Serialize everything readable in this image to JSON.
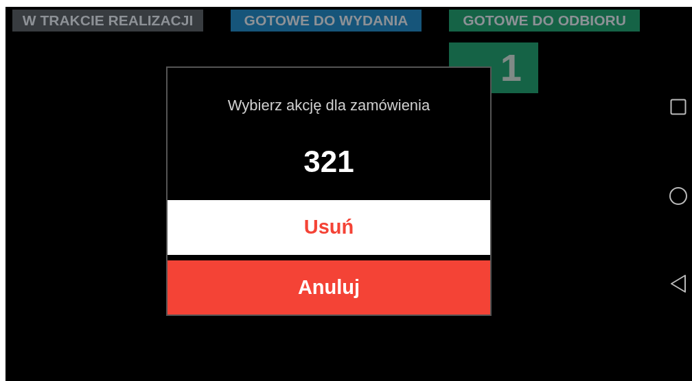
{
  "columns": [
    {
      "title": "W TRAKCIE REALIZACJI",
      "kind": "in_progress"
    },
    {
      "title": "GOTOWE DO WYDANIA",
      "kind": "ready_to_issue"
    },
    {
      "title": "GOTOWE DO ODBIORU",
      "kind": "ready_for_pickup",
      "orders": [
        "1"
      ]
    }
  ],
  "dialog": {
    "title": "Wybierz akcję dla zamówienia",
    "order_number": "321",
    "buttons": [
      {
        "label": "Usuń",
        "kind": "secondary"
      },
      {
        "label": "Anuluj",
        "kind": "primary"
      }
    ]
  }
}
